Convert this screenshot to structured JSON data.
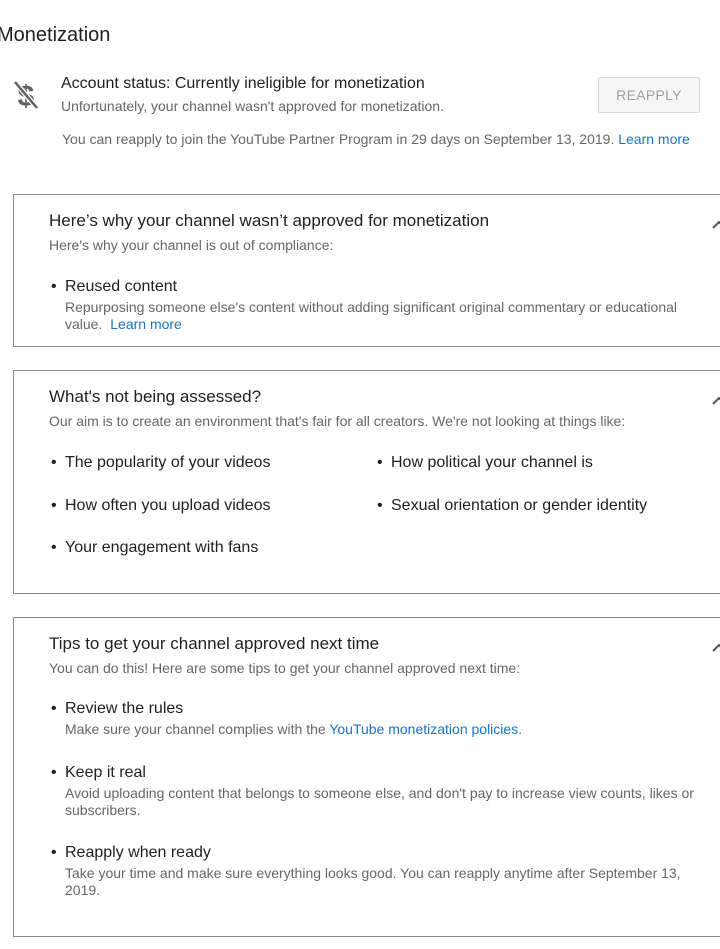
{
  "page": {
    "title": "Monetization"
  },
  "status": {
    "title": "Account status: Currently ineligible for monetization",
    "subtitle": "Unfortunately, your channel wasn't approved for monetization.",
    "reapply_button": "REAPPLY",
    "reapply_note": "You can reapply to join the YouTube Partner Program in 29 days on September 13, 2019.",
    "learn_more": "Learn more"
  },
  "why_card": {
    "title": "Here’s why your channel wasn’t approved for monetization",
    "subtitle": "Here's why your channel is out of compliance:",
    "items": [
      {
        "title": "Reused content",
        "desc_line1": "Repurposing someone else's content without adding significant original commentary or educational",
        "desc_line2": "value.",
        "link": "Learn more"
      }
    ]
  },
  "not_assessed_card": {
    "title": "What's not being assessed?",
    "subtitle": "Our aim is to create an environment that's fair for all creators. We're not looking at things like:",
    "items": [
      "The popularity of your videos",
      "How political your channel is",
      "How often you upload videos",
      "Sexual orientation or gender identity",
      "Your engagement with fans"
    ]
  },
  "tips_card": {
    "title": "Tips to get your channel approved next time",
    "subtitle": "You can do this! Here are some tips to get your channel approved next time:",
    "items": [
      {
        "title": "Review the rules",
        "desc_prefix": "Make sure your channel complies with the ",
        "desc_link": "YouTube monetization policies",
        "desc_suffix": "."
      },
      {
        "title": "Keep it real",
        "desc_line1": "Avoid uploading content that belongs to someone else, and don't pay to increase view counts, likes or",
        "desc_line2": "subscribers."
      },
      {
        "title": "Reapply when ready",
        "desc_line1": "Take your time and make sure everything looks good. You can reapply anytime after September 13,",
        "desc_line2": "2019."
      }
    ]
  },
  "colors": {
    "link": "#1a73c8",
    "border": "#8a8a8a",
    "muted_text": "#666666"
  },
  "icons": {
    "status": "dollar-crossed-icon",
    "collapse": "chevron-up-icon"
  }
}
